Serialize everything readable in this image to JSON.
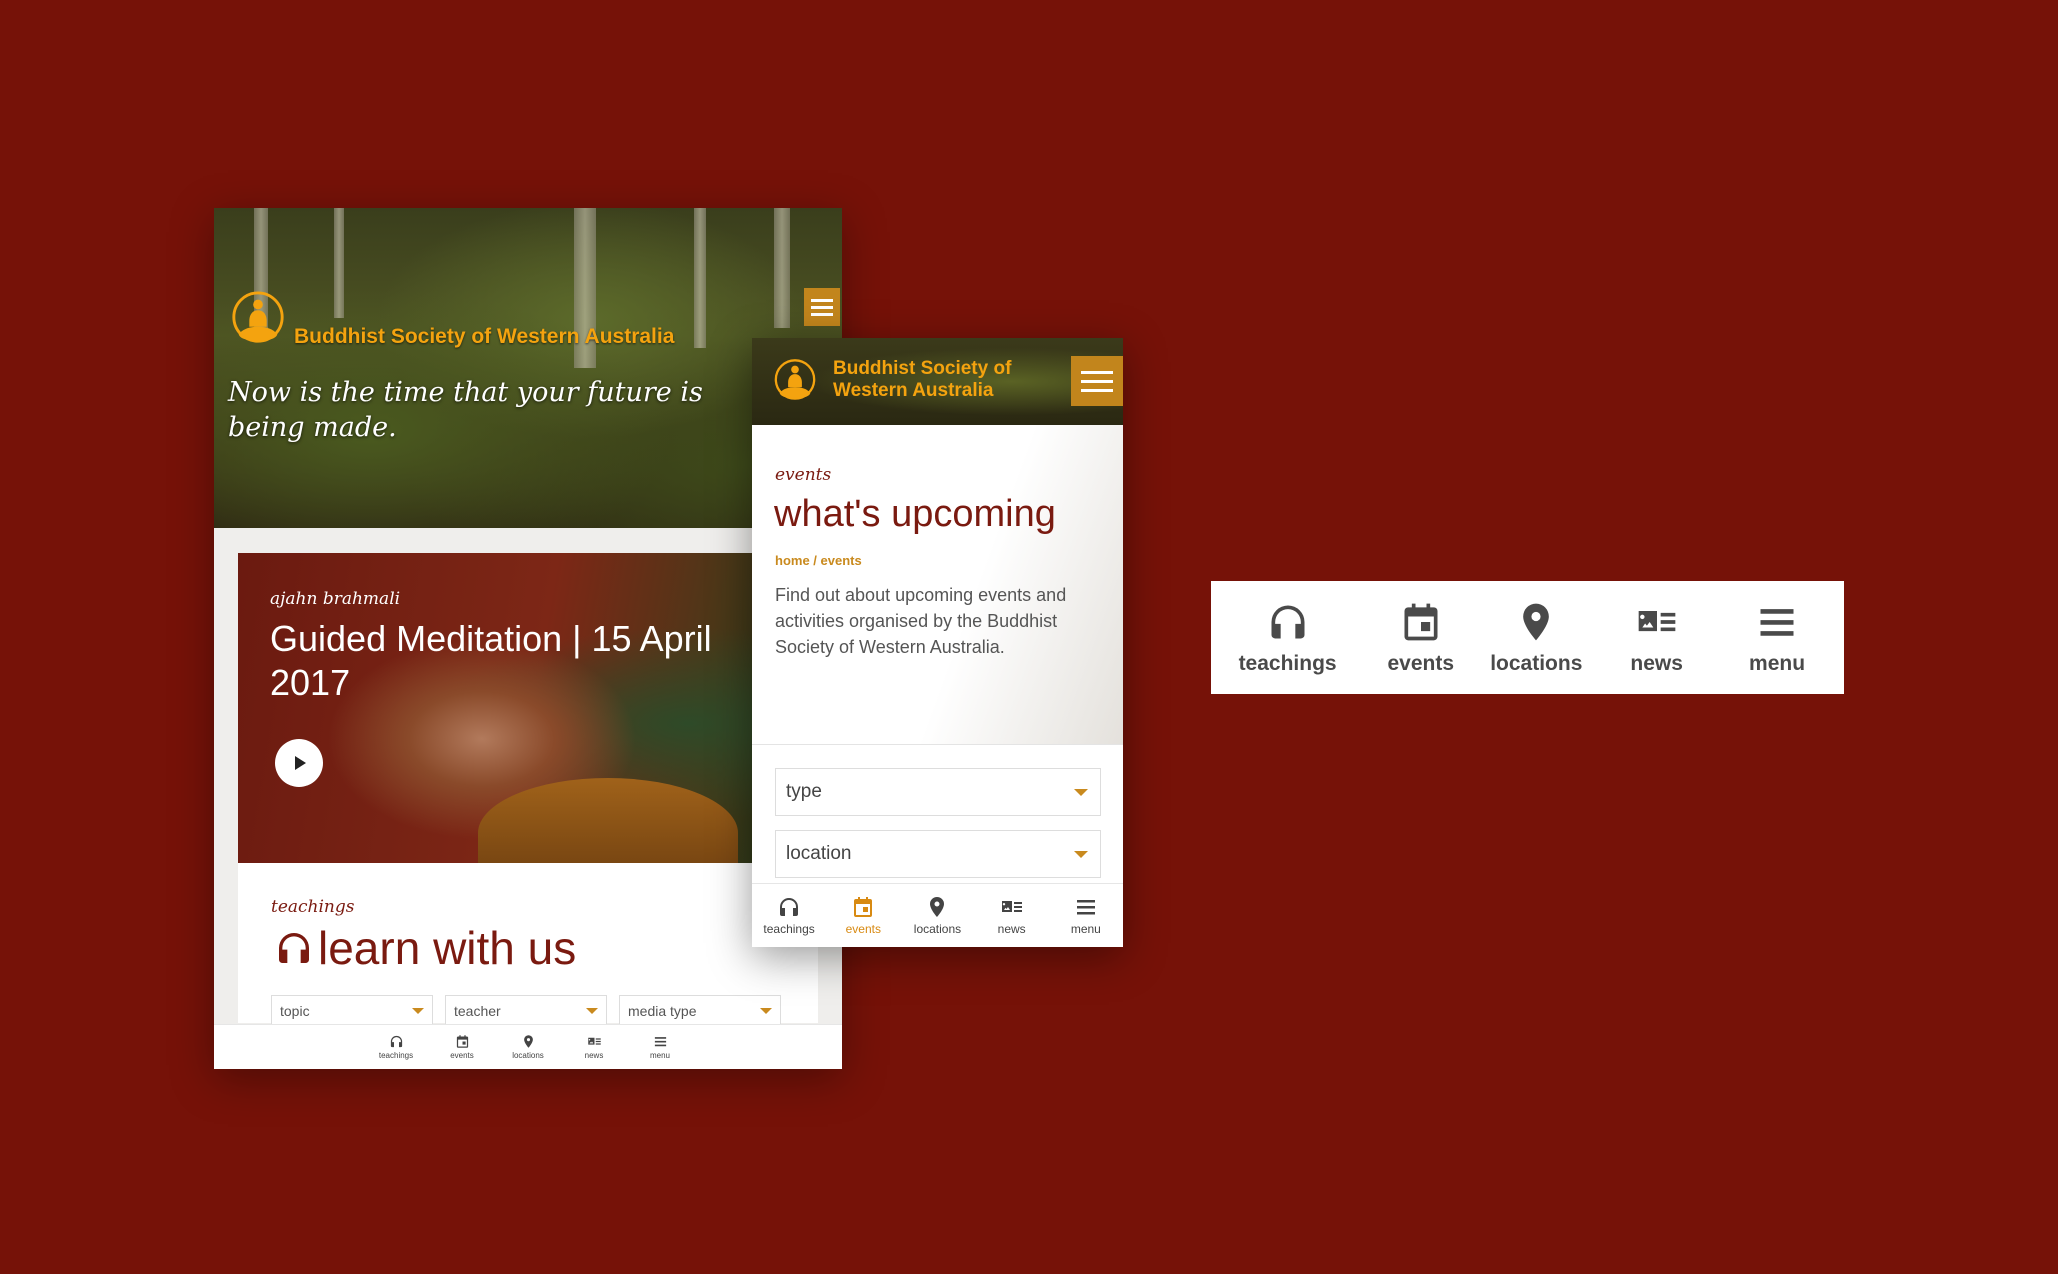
{
  "brand": {
    "name": "Buddhist Society of Western Australia",
    "name_line1": "Buddhist Society of",
    "name_line2": "Western Australia",
    "color": "#f4a30f",
    "accent": "#c2851c",
    "maroon": "#7a1a10"
  },
  "home": {
    "tagline": "Now is the time that your future is being made.",
    "featured": {
      "author": "ajahn brahmali",
      "title": "Guided Meditation | 15 April 2017"
    },
    "teachings": {
      "kicker": "teachings",
      "title": "learn with us",
      "filters": [
        "topic",
        "teacher",
        "media type"
      ]
    }
  },
  "events_page": {
    "kicker": "events",
    "title": "what's upcoming",
    "breadcrumb": "home / events",
    "description": "Find out about upcoming events and activities organised by the Buddhist Society of Western Australia.",
    "selects": [
      {
        "value": "type"
      },
      {
        "value": "location"
      }
    ]
  },
  "nav": {
    "items": [
      {
        "label": "teachings",
        "icon": "headphones-icon"
      },
      {
        "label": "events",
        "icon": "calendar-icon"
      },
      {
        "label": "locations",
        "icon": "map-pin-icon"
      },
      {
        "label": "news",
        "icon": "news-icon"
      },
      {
        "label": "menu",
        "icon": "hamburger-icon"
      }
    ],
    "active_index_events_page": 1,
    "icon_color": "#4a4a4a",
    "active_color": "#d88a12"
  }
}
